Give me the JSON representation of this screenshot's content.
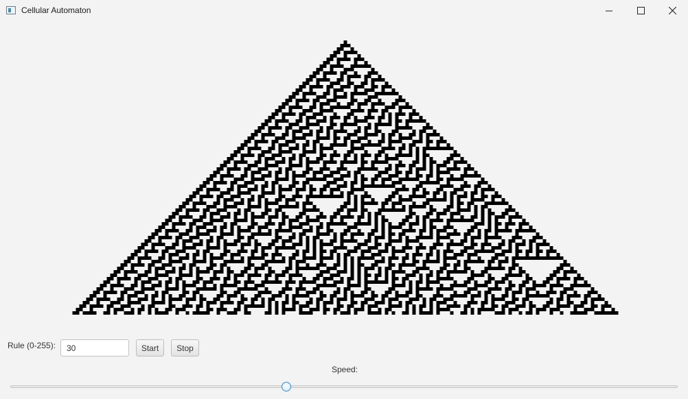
{
  "window": {
    "title": "Cellular Automaton",
    "icon": "app-window-icon"
  },
  "automaton": {
    "rule": 30,
    "generations": 80,
    "cell_color": "#000000",
    "background": "#f3f3f3"
  },
  "controls": {
    "rule_label": "Rule (0-255):",
    "rule_value": "30",
    "start_label": "Start",
    "stop_label": "Stop",
    "speed_label": "Speed:",
    "speed_fraction": 0.41
  }
}
